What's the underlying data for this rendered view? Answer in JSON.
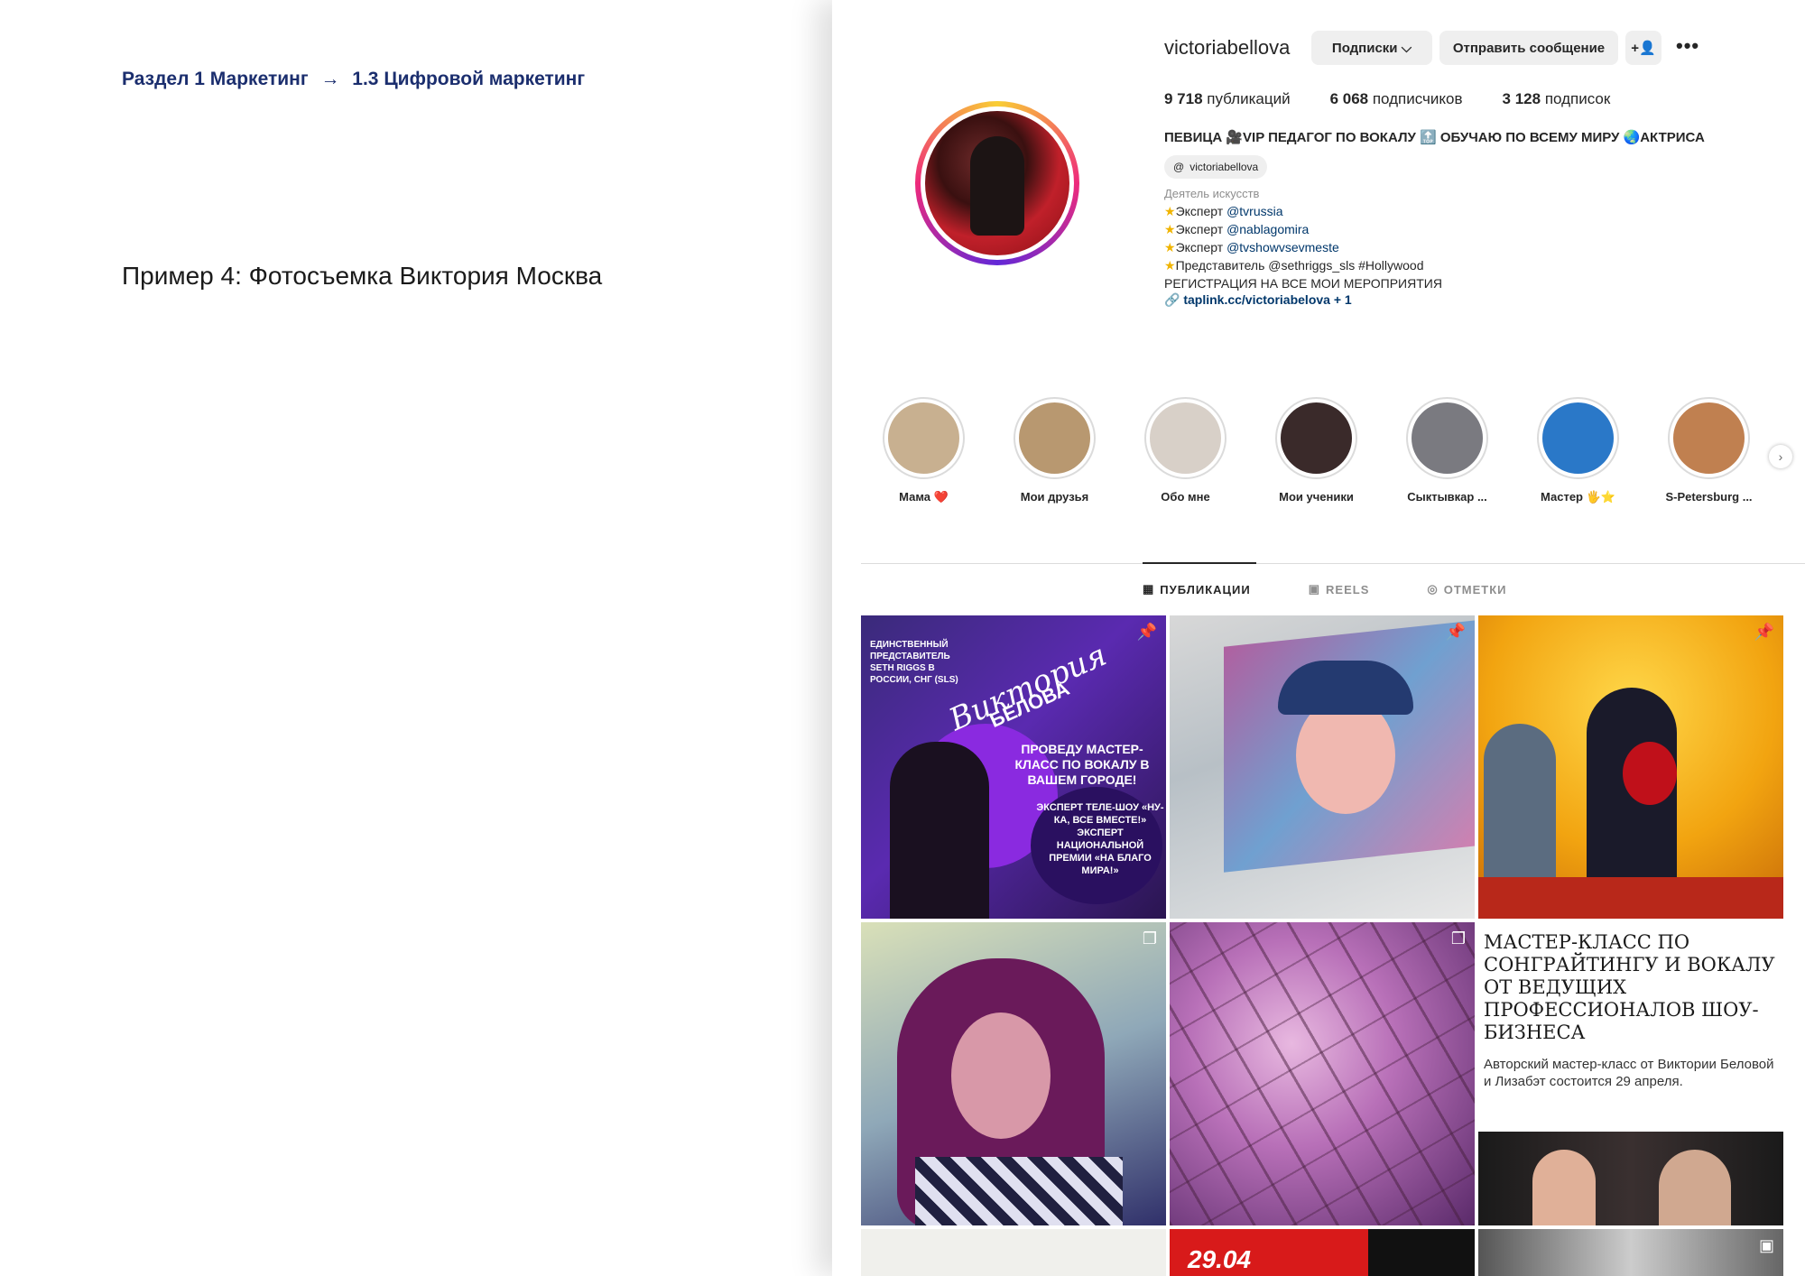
{
  "document": {
    "breadcrumb": {
      "part1": "Раздел 1 Маркетинг",
      "arrow": "→",
      "part2": "1.3 Цифровой маркетинг"
    },
    "subtitle": "Пример 4: Фотосъемка Виктория Москва"
  },
  "profile": {
    "username": "victoriabellova",
    "buttons": {
      "following": "Подписки ⌵",
      "message": "Отправить сообщение",
      "add_user_icon": "+👤",
      "more": "•••"
    },
    "stats": {
      "posts_count": "9 718",
      "posts_label": "публикаций",
      "followers_count": "6 068",
      "followers_label": "подписчиков",
      "following_count": "3 128",
      "following_label": "подписок"
    },
    "bio_title": "ПЕВИЦА 🎥VIP ПЕДАГОГ ПО ВОКАЛУ 🔝 ОБУЧАЮ ПО ВСЕМУ МИРУ 🌏АКТРИСА",
    "threads_handle": "victoriabellova",
    "category": "Деятель искусств",
    "bio_items": [
      {
        "prefix": "Эксперт",
        "mention": "@tvrussia"
      },
      {
        "prefix": "Эксперт",
        "mention": "@nablagomira"
      },
      {
        "prefix": "Эксперт",
        "mention": "@tvshowvsevmeste"
      },
      {
        "prefix": "Представитель",
        "mention": "@sethriggs_sls #Hollywood"
      }
    ],
    "bio_registration": "РЕГИСТРАЦИЯ НА ВСЕ МОИ МЕРОПРИЯТИЯ",
    "link": "taplink.cc/victoriabelova + 1"
  },
  "highlights": [
    {
      "label": "Мама ❤️",
      "color": "#c8b090"
    },
    {
      "label": "Мои друзья",
      "color": "#b89870"
    },
    {
      "label": "Обо мне",
      "color": "#d8d0c8"
    },
    {
      "label": "Мои ученики",
      "color": "#3a2a2a"
    },
    {
      "label": "Сыктывкар ...",
      "color": "#7a7a80"
    },
    {
      "label": "Мастер 🖐⭐",
      "color": "#2a78c8"
    },
    {
      "label": "S-Petersburg ...",
      "color": "#c08050"
    }
  ],
  "tabs": [
    {
      "label": "ПУБЛИКАЦИИ",
      "icon": "grid-icon",
      "active": true
    },
    {
      "label": "REELS",
      "icon": "reels-icon",
      "active": false
    },
    {
      "label": "ОТМЕТКИ",
      "icon": "tagged-icon",
      "active": false
    }
  ],
  "posts": {
    "post1": {
      "top_text": "ЕДИНСТВЕННЫЙ ПРЕДСТАВИТЕЛЬ SETH RIGGS В РОССИИ, СНГ (SLS)",
      "script_name": "Виктория",
      "surname": "БЕЛОВА",
      "cta": "ПРОВЕДУ МАСТЕР-КЛАСС ПО ВОКАЛУ В ВАШЕМ ГОРОДЕ!",
      "circle_text": "ЭКСПЕРТ ТЕЛЕ-ШОУ «НУ-КА, ВСЕ ВМЕСТЕ!» ЭКСПЕРТ НАЦИОНАЛЬНОЙ ПРЕМИИ «НА БЛАГО МИРА!»"
    },
    "post6": {
      "headline": "МАСТЕР-КЛАСС ПО СОНГРАЙТИНГУ И ВОКАЛУ ОТ ВЕДУЩИХ ПРОФЕССИОНАЛОВ ШОУ-БИЗНЕСА",
      "description": "Авторский мастер-класс от Виктории Беловой и Лизабэт состоится 29 апреля."
    },
    "post8_date": "29.04"
  },
  "colors": {
    "breadcrumb": "#1b2e6e",
    "mention": "#00376b",
    "muted": "#8e8e8e"
  }
}
